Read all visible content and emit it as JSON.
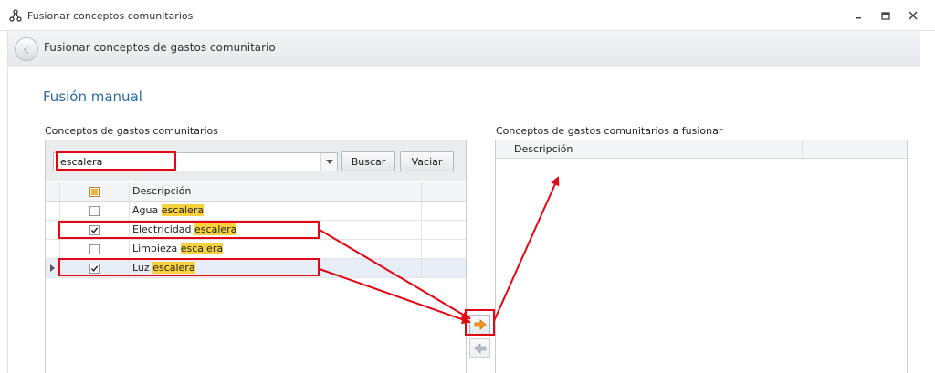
{
  "window": {
    "title": "Fusionar conceptos comunitarios",
    "app_icon": "hierarchy-icon",
    "controls": [
      "minimize-icon",
      "restore-icon",
      "close-icon"
    ]
  },
  "header": {
    "title": "Fusionar conceptos de gastos comunitario",
    "back_icon": "back-arrow-icon"
  },
  "section": {
    "title": "Fusión manual"
  },
  "left": {
    "label": "Conceptos de gastos comunitarios",
    "search": {
      "value": "escalera",
      "placeholder": ""
    },
    "buttons": {
      "search": "Buscar",
      "clear": "Vaciar"
    },
    "grid": {
      "header": "Descripción",
      "rows": [
        {
          "prefix": "Agua ",
          "match": "escalera",
          "checked": false,
          "current": false
        },
        {
          "prefix": "Electricidad ",
          "match": "escalera",
          "checked": true,
          "current": false
        },
        {
          "prefix": "Limpieza ",
          "match": "escalera",
          "checked": false,
          "current": false
        },
        {
          "prefix": "Luz ",
          "match": "escalera",
          "checked": true,
          "current": true
        }
      ]
    }
  },
  "right": {
    "label": "Conceptos de gastos comunitarios a fusionar",
    "grid": {
      "header": "Descripción",
      "rows": []
    }
  },
  "actions": {
    "add_icon": "arrow-right-icon",
    "remove_icon": "arrow-left-icon"
  },
  "colors": {
    "accent": "#2c6aa3",
    "highlight": "#f7d23c",
    "annotation": "#e30613",
    "arrow_orange": "#f29a1f"
  }
}
